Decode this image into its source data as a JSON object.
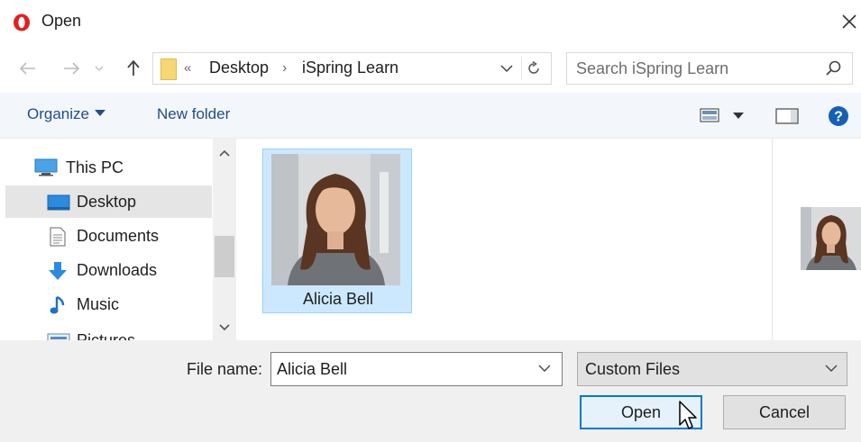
{
  "window": {
    "title": "Open",
    "accent": "#0078d7",
    "brand_color": "#e0201e"
  },
  "address": {
    "overflow_marker": "«",
    "crumbs": [
      "Desktop",
      "iSpring Learn"
    ]
  },
  "search": {
    "placeholder": "Search iSpring Learn"
  },
  "toolbar": {
    "organize_label": "Organize",
    "new_folder_label": "New folder"
  },
  "nav": {
    "items": [
      {
        "label": "This PC",
        "icon": "computer-icon"
      },
      {
        "label": "Desktop",
        "icon": "desktop-folder-icon",
        "selected": true
      },
      {
        "label": "Documents",
        "icon": "documents-icon"
      },
      {
        "label": "Downloads",
        "icon": "downloads-icon"
      },
      {
        "label": "Music",
        "icon": "music-icon"
      },
      {
        "label": "Pictures",
        "icon": "pictures-icon"
      }
    ]
  },
  "files": [
    {
      "name": "Alicia Bell",
      "selected": true
    }
  ],
  "bottom": {
    "file_name_label": "File name:",
    "file_name_value": "Alicia Bell",
    "filter_value": "Custom Files",
    "open_label": "Open",
    "cancel_label": "Cancel"
  }
}
